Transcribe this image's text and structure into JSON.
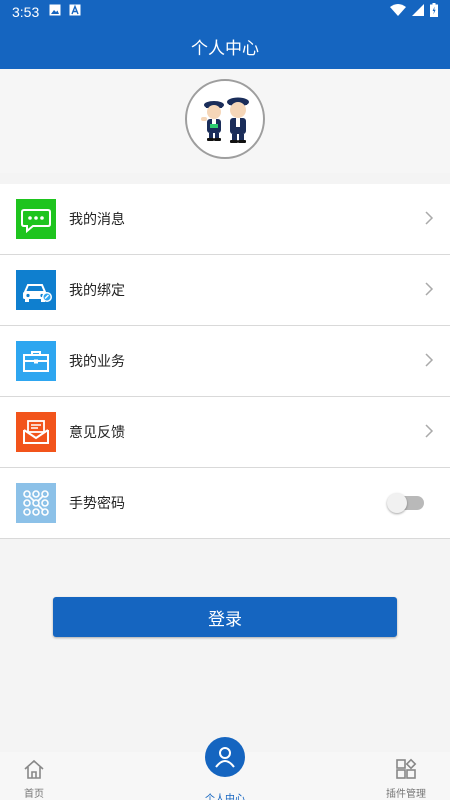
{
  "status_bar": {
    "time": "3:53"
  },
  "header": {
    "title": "个人中心"
  },
  "menu": {
    "items": [
      {
        "label": "我的消息",
        "icon": "message-icon",
        "color": "#1ec41e"
      },
      {
        "label": "我的绑定",
        "icon": "car-bind-icon",
        "color": "#0f7fcf"
      },
      {
        "label": "我的业务",
        "icon": "briefcase-icon",
        "color": "#2ea6f0"
      },
      {
        "label": "意见反馈",
        "icon": "feedback-mail-icon",
        "color": "#f2541b"
      },
      {
        "label": "手势密码",
        "icon": "gesture-grid-icon",
        "color": "#8cc1e8",
        "toggle_on": false
      }
    ]
  },
  "login_button": {
    "label": "登录"
  },
  "tabbar": {
    "home": "首页",
    "center": "个人中心",
    "plugin": "插件管理"
  },
  "colors": {
    "primary": "#1565c0",
    "background": "#f4f4f4"
  }
}
